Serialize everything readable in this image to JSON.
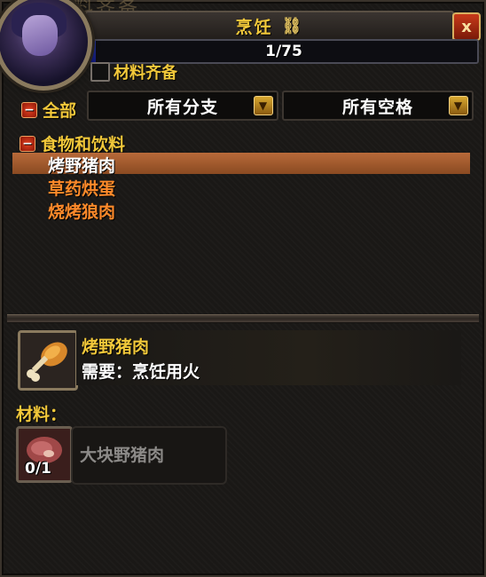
{
  "window": {
    "title": "烹饪",
    "title_link_icon": "link-icon",
    "background_faded_text": "材料齐备",
    "close_label": "x",
    "colors": {
      "title_text": "#f2c83a",
      "selected_row": "#b86a3a",
      "recipe_orange": "#ff8a2a"
    }
  },
  "skill": {
    "progress_text": "1/75",
    "progress_fraction": 0.0133
  },
  "filters": {
    "have_materials_label": "材料齐备",
    "have_materials_checked": false,
    "all_label": "全部",
    "subclass_dropdown": "所有分支",
    "slot_dropdown": "所有空格"
  },
  "recipe_list": {
    "category": "食物和饮料",
    "recipes": [
      {
        "name": "烤野猪肉",
        "selected": true,
        "color": "#ffffff"
      },
      {
        "name": "草药烘蛋",
        "selected": false,
        "color": "#ff8a2a"
      },
      {
        "name": "烧烤狼肉",
        "selected": false,
        "color": "#ff8a2a"
      }
    ]
  },
  "detail": {
    "name": "烤野猪肉",
    "requires": "需要：烹饪用火",
    "icon": "roasted-meat-icon",
    "materials_label": "材料：",
    "reagent": {
      "name": "大块野猪肉",
      "count": "0/1",
      "icon": "boar-meat-icon"
    }
  }
}
